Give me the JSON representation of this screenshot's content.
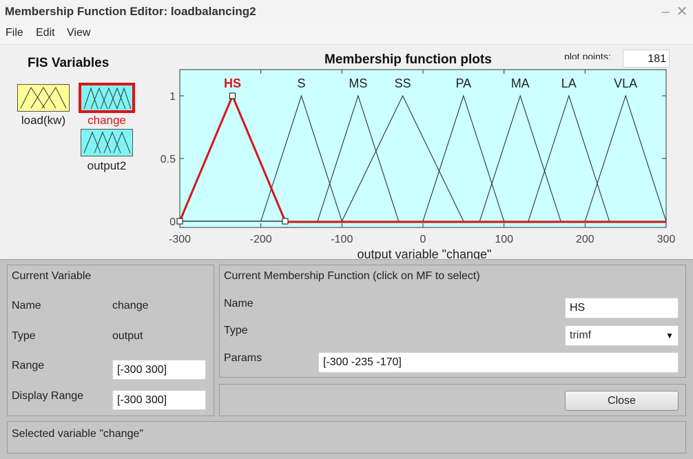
{
  "window": {
    "title": "Membership Function Editor: loadbalancing2",
    "minimize_glyph": "–",
    "close_glyph": "✕"
  },
  "menu": [
    "File",
    "Edit",
    "View"
  ],
  "fis": {
    "title": "FIS Variables",
    "variables": [
      {
        "name": "load(kw)",
        "kind": "input",
        "selected": false,
        "box_color": "#ffff99"
      },
      {
        "name": "change",
        "kind": "output",
        "selected": true,
        "box_color": "#7ff4f4"
      },
      {
        "name": "output2",
        "kind": "output",
        "selected": false,
        "box_color": "#7ff4f4"
      }
    ]
  },
  "plot": {
    "title": "Membership function plots",
    "plot_points_label": "plot points:",
    "plot_points_value": "181",
    "background": "#ccffff",
    "selected_color": "#d91616"
  },
  "chart_data": {
    "type": "line",
    "title": "Membership function plots",
    "xlabel": "output variable \"change\"",
    "xlim": [
      -300,
      300
    ],
    "ylim": [
      0,
      1.1
    ],
    "xticks": [
      "-300",
      "-200",
      "-100",
      "0",
      "100",
      "200",
      "300"
    ],
    "yticks": [
      "0",
      "0.5",
      "1"
    ],
    "grid": false,
    "series": [
      {
        "name": "HS",
        "params": [
          -300,
          -235,
          -170
        ],
        "selected": true
      },
      {
        "name": "S",
        "params": [
          -200,
          -150,
          -100
        ]
      },
      {
        "name": "MS",
        "params": [
          -130,
          -80,
          -30
        ]
      },
      {
        "name": "SS",
        "params": [
          -100,
          -25,
          50
        ]
      },
      {
        "name": "PA",
        "params": [
          0,
          50,
          100
        ]
      },
      {
        "name": "MA",
        "params": [
          70,
          120,
          170
        ]
      },
      {
        "name": "LA",
        "params": [
          130,
          180,
          230
        ]
      },
      {
        "name": "VLA",
        "params": [
          200,
          250,
          300
        ]
      }
    ]
  },
  "current_variable": {
    "title": "Current Variable",
    "name_label": "Name",
    "name": "change",
    "type_label": "Type",
    "type": "output",
    "range_label": "Range",
    "range": "[-300 300]",
    "display_range_label": "Display Range",
    "display_range": "[-300 300]"
  },
  "current_mf": {
    "title": "Current Membership Function (click on MF to select)",
    "name_label": "Name",
    "name": "HS",
    "type_label": "Type",
    "type": "trimf",
    "params_label": "Params",
    "params": "[-300 -235 -170]"
  },
  "close_label": "Close",
  "status": "Selected variable \"change\""
}
